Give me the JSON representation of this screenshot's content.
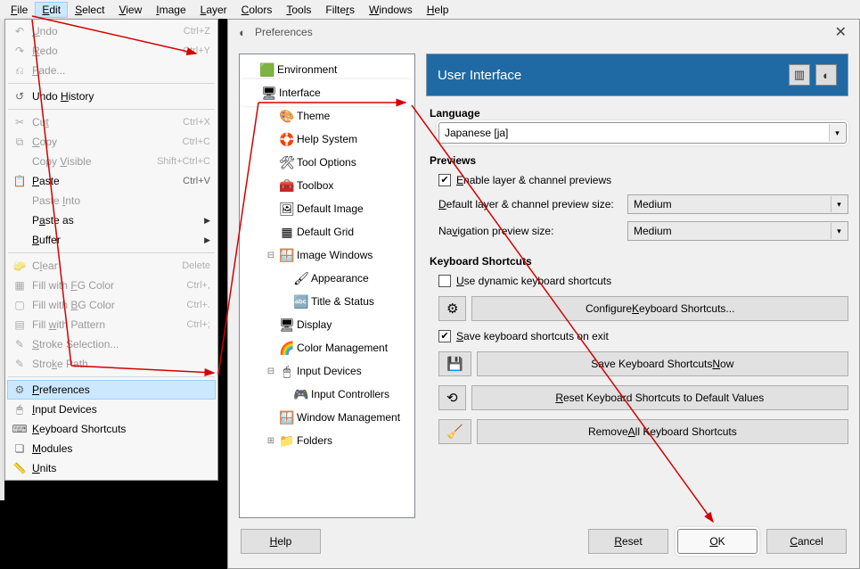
{
  "menubar": {
    "items": [
      {
        "label": "File",
        "u": "F"
      },
      {
        "label": "Edit",
        "u": "E",
        "highlight": true
      },
      {
        "label": "Select",
        "u": "S"
      },
      {
        "label": "View",
        "u": "V"
      },
      {
        "label": "Image",
        "u": "I"
      },
      {
        "label": "Layer",
        "u": "L"
      },
      {
        "label": "Colors",
        "u": "C"
      },
      {
        "label": "Tools",
        "u": "T"
      },
      {
        "label": "Filters",
        "u": "r"
      },
      {
        "label": "Windows",
        "u": "W"
      },
      {
        "label": "Help",
        "u": "H"
      }
    ]
  },
  "edit_menu": {
    "items": [
      {
        "icon": "↶",
        "label": "Undo",
        "shortcut": "Ctrl+Z",
        "disabled": true,
        "u": "U"
      },
      {
        "icon": "↷",
        "label": "Redo",
        "shortcut": "Ctrl+Y",
        "disabled": true,
        "u": "R"
      },
      {
        "icon": "⎌",
        "label": "Fade...",
        "disabled": true,
        "u": "F"
      },
      {
        "sep": true
      },
      {
        "icon": "↺",
        "label": "Undo History",
        "u": "H"
      },
      {
        "sep": true
      },
      {
        "icon": "✂",
        "label": "Cut",
        "shortcut": "Ctrl+X",
        "disabled": true,
        "u": "t"
      },
      {
        "icon": "⧉",
        "label": "Copy",
        "shortcut": "Ctrl+C",
        "disabled": true,
        "u": "C"
      },
      {
        "icon": "",
        "label": "Copy Visible",
        "shortcut": "Shift+Ctrl+C",
        "disabled": true,
        "u": "V"
      },
      {
        "icon": "📋",
        "label": "Paste",
        "shortcut": "Ctrl+V",
        "u": "P"
      },
      {
        "icon": "",
        "label": "Paste Into",
        "disabled": true,
        "u": "I"
      },
      {
        "icon": "",
        "label": "Paste as",
        "u": "a",
        "submenu": true
      },
      {
        "icon": "",
        "label": "Buffer",
        "u": "B",
        "submenu": true
      },
      {
        "sep": true
      },
      {
        "icon": "🧽",
        "label": "Clear",
        "shortcut": "Delete",
        "disabled": true,
        "u": "l"
      },
      {
        "icon": "▦",
        "label": "Fill with FG Color",
        "shortcut": "Ctrl+,",
        "disabled": true,
        "u": "FG"
      },
      {
        "icon": "▢",
        "label": "Fill with BG Color",
        "shortcut": "Ctrl+.",
        "disabled": true,
        "u": "BG"
      },
      {
        "icon": "▤",
        "label": "Fill with Pattern",
        "shortcut": "Ctrl+;",
        "disabled": true,
        "u": "w"
      },
      {
        "icon": "✎",
        "label": "Stroke Selection...",
        "disabled": true,
        "u": "S"
      },
      {
        "icon": "✎",
        "label": "Stroke Path...",
        "disabled": true,
        "u": "k"
      },
      {
        "sep": true
      },
      {
        "icon": "⚙",
        "label": "Preferences",
        "u": "P",
        "highlight": true
      },
      {
        "icon": "🖱",
        "label": "Input Devices",
        "u": "I"
      },
      {
        "icon": "⌨",
        "label": "Keyboard Shortcuts",
        "u": "K"
      },
      {
        "icon": "❏",
        "label": "Modules",
        "u": "M"
      },
      {
        "icon": "📏",
        "label": "Units",
        "u": "U"
      }
    ]
  },
  "dialog": {
    "title": "Preferences",
    "banner_title": "User Interface",
    "nav": [
      {
        "icon": "🟩",
        "label": "Environment"
      },
      {
        "icon": "🖥",
        "label": "Interface",
        "selected": true
      },
      {
        "icon": "🎨",
        "label": "Theme",
        "indent": 1
      },
      {
        "icon": "🛟",
        "label": "Help System",
        "indent": 1
      },
      {
        "icon": "🛠",
        "label": "Tool Options",
        "indent": 1
      },
      {
        "icon": "🧰",
        "label": "Toolbox",
        "indent": 1
      },
      {
        "icon": "🖼",
        "label": "Default Image",
        "indent": 1
      },
      {
        "icon": "▦",
        "label": "Default Grid",
        "indent": 1
      },
      {
        "exp": "⊟",
        "icon": "🪟",
        "label": "Image Windows",
        "indent": 1
      },
      {
        "icon": "🖌",
        "label": "Appearance",
        "indent": 2
      },
      {
        "icon": "🔤",
        "label": "Title & Status",
        "indent": 2
      },
      {
        "icon": "🖥",
        "label": "Display",
        "indent": 1
      },
      {
        "icon": "🌈",
        "label": "Color Management",
        "indent": 1
      },
      {
        "exp": "⊟",
        "icon": "🖱",
        "label": "Input Devices",
        "indent": 1
      },
      {
        "icon": "🎮",
        "label": "Input Controllers",
        "indent": 2
      },
      {
        "icon": "🪟",
        "label": "Window Management",
        "indent": 1
      },
      {
        "exp": "⊞",
        "icon": "📁",
        "label": "Folders",
        "indent": 1
      }
    ],
    "language": {
      "label": "Language",
      "value": "Japanese [ja]"
    },
    "previews": {
      "label": "Previews",
      "enable": "Enable layer & channel previews",
      "enable_checked": true,
      "row1_label": "Default layer & channel preview size:",
      "row1_value": "Medium",
      "row2_label": "Navigation preview size:",
      "row2_value": "Medium"
    },
    "keyboard": {
      "label": "Keyboard Shortcuts",
      "dynamic": "Use dynamic keyboard shortcuts",
      "dynamic_checked": false,
      "configure": "Configure Keyboard Shortcuts...",
      "save_exit": "Save keyboard shortcuts on exit",
      "save_exit_checked": true,
      "save_now": "Save Keyboard Shortcuts Now",
      "reset": "Reset Keyboard Shortcuts to Default Values",
      "remove": "Remove All Keyboard Shortcuts"
    },
    "buttons": {
      "help": "Help",
      "reset": "Reset",
      "ok": "OK",
      "cancel": "Cancel"
    }
  }
}
